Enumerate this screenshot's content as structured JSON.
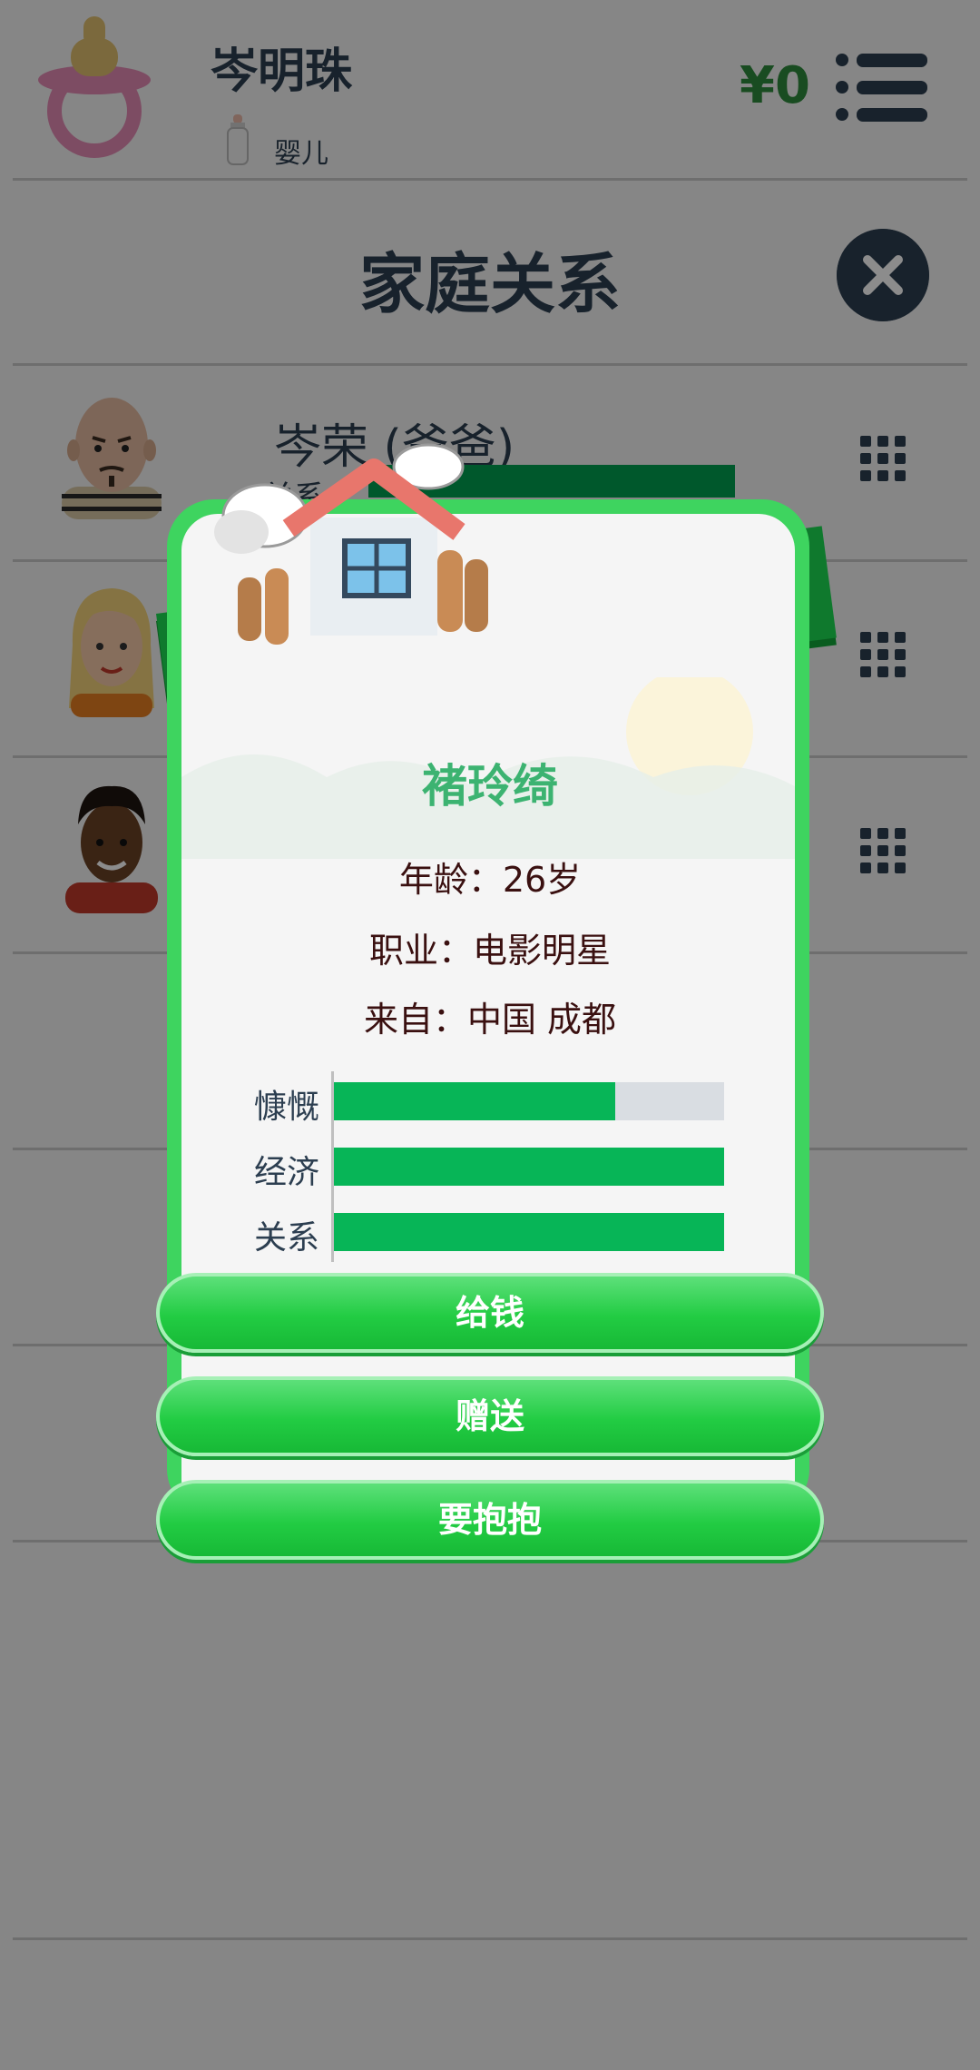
{
  "header": {
    "player_name": "岑明珠",
    "life_stage": "婴儿",
    "money": "¥0"
  },
  "page": {
    "title": "家庭关系"
  },
  "family_list": [
    {
      "name": "岑荣 (爸爸)",
      "relation_label": "关系"
    },
    {
      "name": "",
      "relation_label": ""
    },
    {
      "name": "",
      "relation_label": ""
    }
  ],
  "modal": {
    "banner_label": "家庭",
    "person_name": "褚玲绮",
    "age_line": "年龄：26岁",
    "job_line": "职业：电影明星",
    "from_line": "来自：中国 成都",
    "stats": [
      {
        "label": "慷慨",
        "value": 0.72
      },
      {
        "label": "经济",
        "value": 1.0
      },
      {
        "label": "关系",
        "value": 1.0
      }
    ],
    "actions": [
      "给钱",
      "赠送",
      "要抱抱"
    ]
  },
  "colors": {
    "card_border": "#3ed45f",
    "banner": "#1ddc53",
    "stat_fill": "#07b557",
    "stat_track": "#d9dde2",
    "money": "#2e8b3c",
    "dark": "#2c3e50"
  },
  "icons": {
    "player_avatar": "pacifier-icon",
    "stage_icon": "baby-bottle-icon",
    "menu": "list-menu-icon",
    "close": "close-icon",
    "row_action": "grid-icon",
    "banner_art": "house-icon"
  }
}
